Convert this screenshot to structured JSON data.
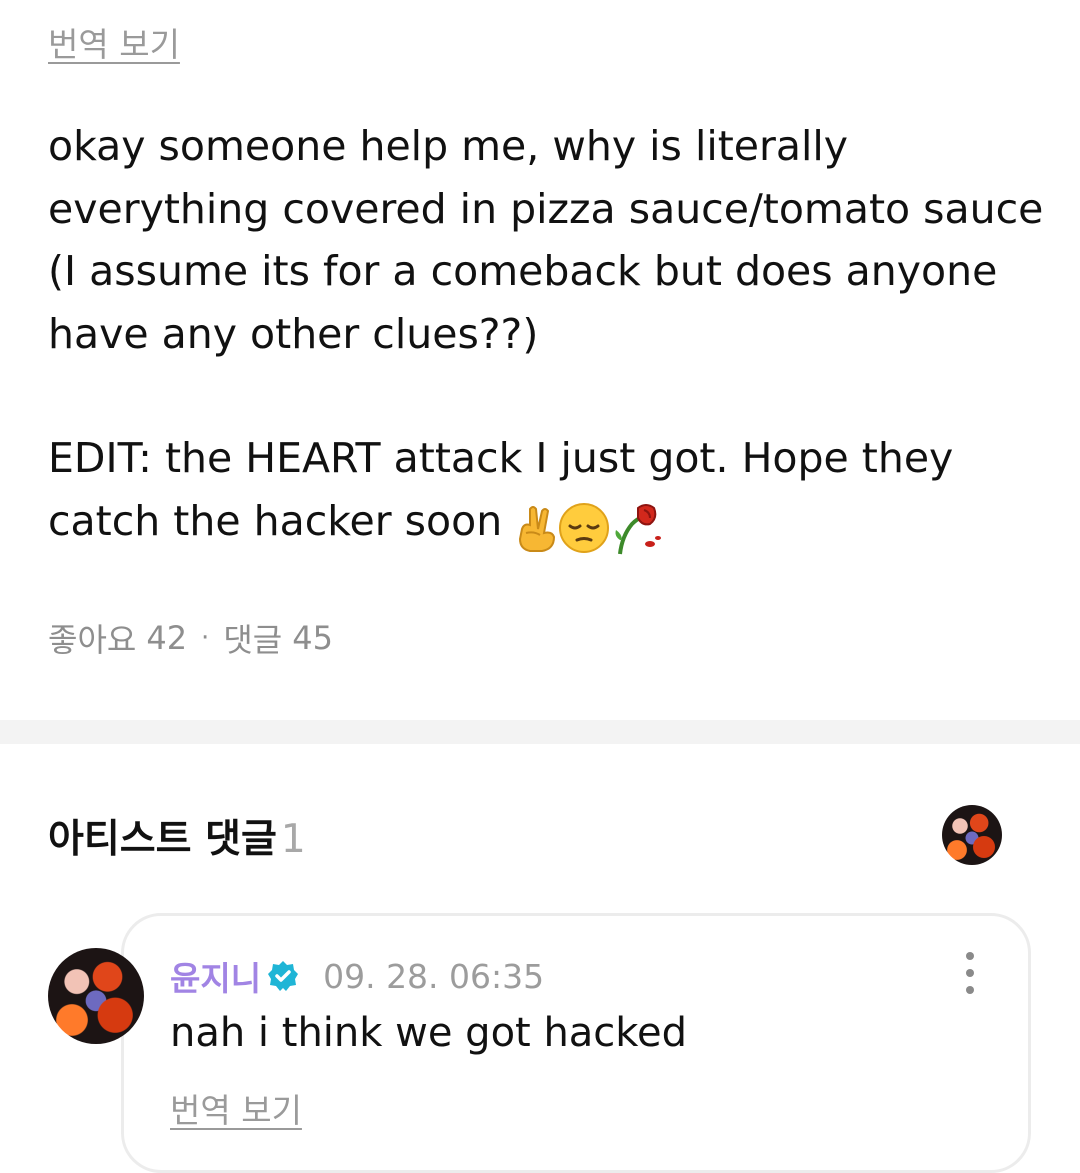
{
  "post": {
    "translate_label": "번역 보기",
    "paragraph1": "okay someone help me, why is literally everything covered in pizza sauce/tomato sauce (I assume its for a comeback but does anyone have any other clues??)",
    "paragraph2": "EDIT: the HEART attack I just got. Hope they catch the hacker soon",
    "emojis": [
      "crossed-fingers-icon",
      "pensive-face-icon",
      "wilted-rose-icon"
    ],
    "likes_label": "좋아요",
    "likes_count": "42",
    "separator": "·",
    "comments_label": "댓글",
    "comments_count": "45"
  },
  "artist_comments": {
    "title": "아티스트 댓글",
    "count": "1",
    "items": [
      {
        "author": "윤지니",
        "verified": true,
        "timestamp": "09. 28. 06:35",
        "text": "nah i think we got hacked",
        "translate_label": "번역 보기"
      }
    ]
  },
  "colors": {
    "author": "#a184e4",
    "verified_badge": "#1fb5d6",
    "muted_text": "#9a9a9a",
    "divider": "#f3f3f3"
  }
}
